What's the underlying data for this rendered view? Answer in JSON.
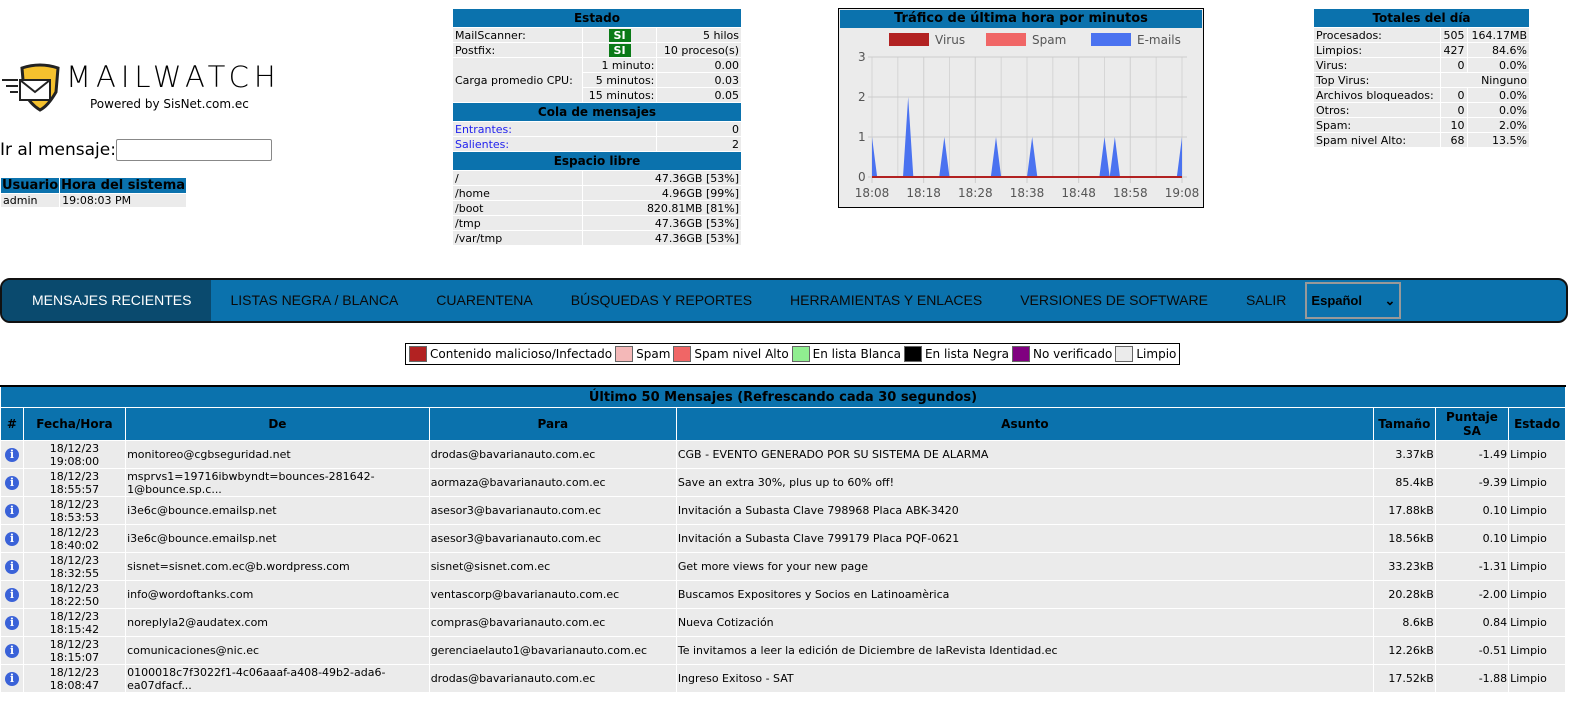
{
  "logo": {
    "text": "MAILWATCH",
    "powered": "Powered by SisNet.com.ec"
  },
  "goto": {
    "label": "Ir al mensaje:",
    "value": ""
  },
  "user": {
    "headers": [
      "Usuario",
      "Hora del sistema"
    ],
    "name": "admin",
    "time": "19:08:03 PM"
  },
  "estado": {
    "title": "Estado",
    "mailscanner": {
      "label": "MailScanner:",
      "status": "SI",
      "value": "5 hilos"
    },
    "postfix": {
      "label": "Postfix:",
      "status": "SI",
      "value": "10 proceso(s)"
    },
    "cpu": {
      "label": "Carga promedio CPU:",
      "rows": [
        {
          "label": "1 minuto:",
          "value": "0.00"
        },
        {
          "label": "5 minutos:",
          "value": "0.03"
        },
        {
          "label": "15 minutos:",
          "value": "0.05"
        }
      ]
    },
    "queue_title": "Cola de mensajes",
    "queue": [
      {
        "label": "Entrantes:",
        "value": "0"
      },
      {
        "label": "Salientes:",
        "value": "2"
      }
    ],
    "disk_title": "Espacio libre",
    "disks": [
      {
        "path": "/",
        "value": "47.36GB [53%]"
      },
      {
        "path": "/home",
        "value": "4.96GB [99%]"
      },
      {
        "path": "/boot",
        "value": "820.81MB [81%]"
      },
      {
        "path": "/tmp",
        "value": "47.36GB [53%]"
      },
      {
        "path": "/var/tmp",
        "value": "47.36GB [53%]"
      }
    ]
  },
  "chart_data": {
    "type": "area",
    "title": "Tráfico de última hora por minutos",
    "ylim": [
      0,
      3
    ],
    "yticks": [
      "0",
      "1",
      "2",
      "3"
    ],
    "xticks": [
      "18:08",
      "18:18",
      "18:28",
      "18:38",
      "18:48",
      "18:58",
      "19:08"
    ],
    "grid": true,
    "legend": "top",
    "x_start": "18:08",
    "x_end": "19:08",
    "x_step_minutes": 1,
    "series": [
      {
        "name": "Virus",
        "color": "#b22222",
        "peaks": {}
      },
      {
        "name": "Spam",
        "color": "#f06666",
        "peaks": {}
      },
      {
        "name": "E-mails",
        "color": "#4a72f0",
        "peaks": {
          "18:08": 1,
          "18:15": 2,
          "18:22": 1,
          "18:32": 1,
          "18:39": 1,
          "18:53": 1,
          "18:55": 1,
          "19:08": 1
        }
      }
    ]
  },
  "totales": {
    "title": "Totales del día",
    "rows": [
      {
        "label": "Procesados:",
        "count": "505",
        "value": "164.17MB"
      },
      {
        "label": "Limpios:",
        "count": "427",
        "value": "84.6%"
      },
      {
        "label": "Virus:",
        "count": "0",
        "value": "0.0%"
      },
      {
        "label": "Top Virus:",
        "count": "",
        "value": "Ninguno"
      },
      {
        "label": "Archivos bloqueados:",
        "count": "0",
        "value": "0.0%"
      },
      {
        "label": "Otros:",
        "count": "0",
        "value": "0.0%"
      },
      {
        "label": "Spam:",
        "count": "10",
        "value": "2.0%"
      },
      {
        "label": "Spam nivel Alto:",
        "count": "68",
        "value": "13.5%"
      }
    ]
  },
  "nav": {
    "items": [
      "MENSAJES RECIENTES",
      "LISTAS NEGRA / BLANCA",
      "CUARENTENA",
      "BÚSQUEDAS Y REPORTES",
      "HERRAMIENTAS Y ENLACES",
      "VERSIONES DE SOFTWARE",
      "SALIR"
    ],
    "language": "Español"
  },
  "legend": [
    {
      "label": "Contenido malicioso/Infectado",
      "color": "#b22222"
    },
    {
      "label": "Spam",
      "color": "#f4b8b8"
    },
    {
      "label": "Spam nivel Alto",
      "color": "#f06666"
    },
    {
      "label": "En lista Blanca",
      "color": "#90ee90"
    },
    {
      "label": "En lista Negra",
      "color": "#000000"
    },
    {
      "label": "No verificado",
      "color": "#800080"
    },
    {
      "label": "Limpio",
      "color": "#ebebeb"
    }
  ],
  "messages": {
    "caption": "Último 50 Mensajes (Refrescando cada 30 segundos)",
    "headers": [
      "#",
      "Fecha/Hora",
      "De",
      "Para",
      "Asunto",
      "Tamaño",
      "Puntaje SA",
      "Estado"
    ],
    "rows": [
      {
        "date": "18/12/23",
        "time": "19:08:00",
        "from": "monitoreo@cgbseguridad.net",
        "to": "drodas@bavarianauto.com.ec",
        "subject": "CGB - EVENTO GENERADO POR SU SISTEMA DE ALARMA",
        "size": "3.37kB",
        "score": "-1.49",
        "status": "Limpio"
      },
      {
        "date": "18/12/23",
        "time": "18:55:57",
        "from": "msprvs1=19716ibwbyndt=bounces-281642-1@bounce.sp.c...",
        "to": "aormaza@bavarianauto.com.ec",
        "subject": "Save an extra 30%, plus up to 60% off!",
        "size": "85.4kB",
        "score": "-9.39",
        "status": "Limpio"
      },
      {
        "date": "18/12/23",
        "time": "18:53:53",
        "from": "i3e6c@bounce.emailsp.net",
        "to": "asesor3@bavarianauto.com.ec",
        "subject": "Invitación a Subasta Clave 798968 Placa ABK-3420",
        "size": "17.88kB",
        "score": "0.10",
        "status": "Limpio"
      },
      {
        "date": "18/12/23",
        "time": "18:40:02",
        "from": "i3e6c@bounce.emailsp.net",
        "to": "asesor3@bavarianauto.com.ec",
        "subject": "Invitación a Subasta Clave 799179 Placa PQF-0621",
        "size": "18.56kB",
        "score": "0.10",
        "status": "Limpio"
      },
      {
        "date": "18/12/23",
        "time": "18:32:55",
        "from": "sisnet=sisnet.com.ec@b.wordpress.com",
        "to": "sisnet@sisnet.com.ec",
        "subject": "Get more views for your new page",
        "size": "33.23kB",
        "score": "-1.31",
        "status": "Limpio"
      },
      {
        "date": "18/12/23",
        "time": "18:22:50",
        "from": "info@wordoftanks.com",
        "to": "ventascorp@bavarianauto.com.ec",
        "subject": "Buscamos Expositores y Socios en Latinoamèrica",
        "size": "20.28kB",
        "score": "-2.00",
        "status": "Limpio"
      },
      {
        "date": "18/12/23",
        "time": "18:15:42",
        "from": "noreplyla2@audatex.com",
        "to": "compras@bavarianauto.com.ec",
        "subject": "Nueva Cotización",
        "size": "8.6kB",
        "score": "0.84",
        "status": "Limpio"
      },
      {
        "date": "18/12/23",
        "time": "18:15:07",
        "from": "comunicaciones@nic.ec",
        "to": "gerenciaelauto1@bavarianauto.com.ec",
        "subject": "Te invitamos a leer la edición de Diciembre de laRevista Identidad.ec",
        "size": "12.26kB",
        "score": "-0.51",
        "status": "Limpio"
      },
      {
        "date": "18/12/23",
        "time": "18:08:47",
        "from": "0100018c7f3022f1-4c06aaaf-a408-49b2-ada6-ea07dfacf...",
        "to": "drodas@bavarianauto.com.ec",
        "subject": "Ingreso Exitoso - SAT",
        "size": "17.52kB",
        "score": "-1.88",
        "status": "Limpio"
      }
    ]
  }
}
